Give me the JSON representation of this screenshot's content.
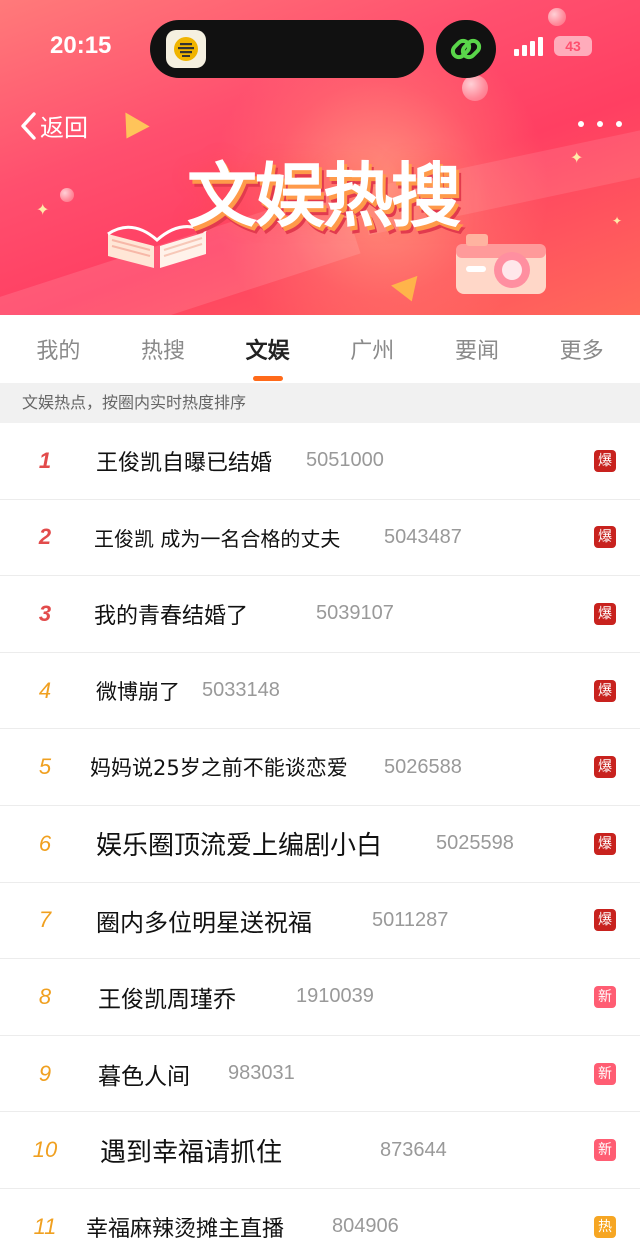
{
  "status_bar": {
    "time": "20:15",
    "battery": "43"
  },
  "nav": {
    "back_label": "返回"
  },
  "banner": {
    "title": "文娱热搜"
  },
  "tabs": [
    {
      "label": "我的"
    },
    {
      "label": "热搜"
    },
    {
      "label": "文娱",
      "active": true
    },
    {
      "label": "广州"
    },
    {
      "label": "要闻"
    },
    {
      "label": "更多"
    }
  ],
  "subheader": "文娱热点，按圈内实时热度排序",
  "items": [
    {
      "rank": "1",
      "title": "王俊凯自曝已结婚",
      "heat": "5051000",
      "badge": "爆",
      "badge_type": "boom"
    },
    {
      "rank": "2",
      "title": "王俊凯 成为一名合格的丈夫",
      "heat": "5043487",
      "badge": "爆",
      "badge_type": "boom"
    },
    {
      "rank": "3",
      "title": "我的青春结婚了",
      "heat": "5039107",
      "badge": "爆",
      "badge_type": "boom"
    },
    {
      "rank": "4",
      "title": "微博崩了",
      "heat": "5033148",
      "badge": "爆",
      "badge_type": "boom"
    },
    {
      "rank": "5",
      "title": "妈妈说25岁之前不能谈恋爱",
      "heat": "5026588",
      "badge": "爆",
      "badge_type": "boom"
    },
    {
      "rank": "6",
      "title": "娱乐圈顶流爱上编剧小白",
      "heat": "5025598",
      "badge": "爆",
      "badge_type": "boom"
    },
    {
      "rank": "7",
      "title": "圈内多位明星送祝福",
      "heat": "5011287",
      "badge": "爆",
      "badge_type": "boom"
    },
    {
      "rank": "8",
      "title": "王俊凯周瑾乔",
      "heat": "1910039",
      "badge": "新",
      "badge_type": "new"
    },
    {
      "rank": "9",
      "title": "暮色人间",
      "heat": "983031",
      "badge": "新",
      "badge_type": "new"
    },
    {
      "rank": "10",
      "title": "遇到幸福请抓住",
      "heat": "873644",
      "badge": "新",
      "badge_type": "new"
    },
    {
      "rank": "11",
      "title": "幸福麻辣烫摊主直播",
      "heat": "804906",
      "badge": "热",
      "badge_type": "hot"
    }
  ],
  "colors": {
    "accent": "#ff6a1a",
    "rank_top": "#e24b4b",
    "rank_other": "#f0a020",
    "boom": "#c8221e",
    "new": "#ff5d73",
    "hot": "#f6a623"
  }
}
